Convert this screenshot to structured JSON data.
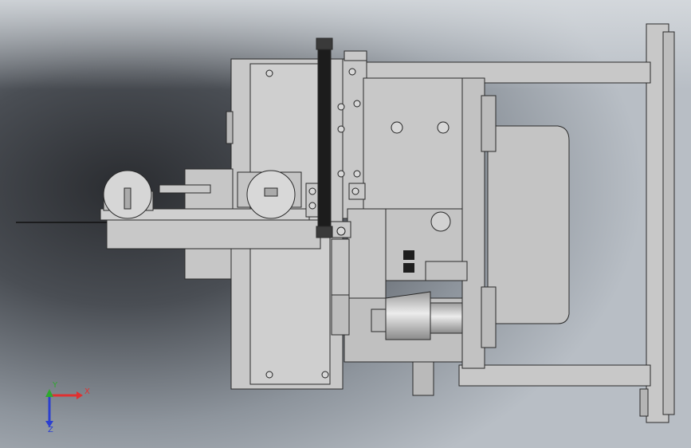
{
  "viewport": {
    "background_gradient": [
      "#c9ced4",
      "#3a3d42",
      "#9aa2ab"
    ],
    "model_color": "#c8c8c8"
  },
  "triad": {
    "x_label": "X",
    "y_label": "Y",
    "z_label": "Z",
    "x_color": "#e03030",
    "y_color": "#2fa82f",
    "z_color": "#2b3fd0"
  }
}
